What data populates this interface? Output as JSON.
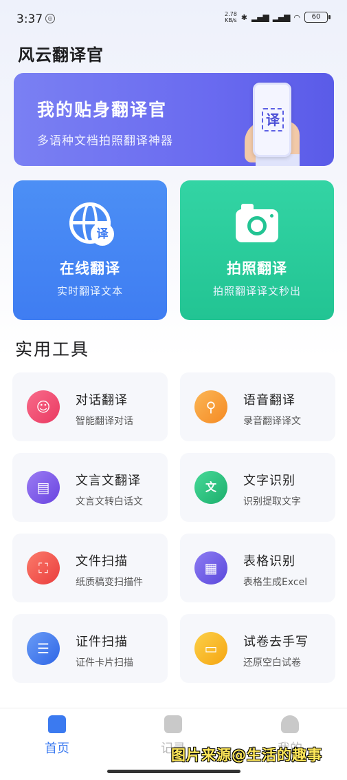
{
  "status_bar": {
    "time": "3:37",
    "net_speed_value": "2.78",
    "net_speed_unit": "KB/s",
    "battery": "60"
  },
  "app": {
    "title": "风云翻译官"
  },
  "banner": {
    "title": "我的贴身翻译官",
    "subtitle": "多语种文档拍照翻译神器",
    "phone_glyph": "译"
  },
  "main_cards": [
    {
      "title": "在线翻译",
      "subtitle": "实时翻译文本",
      "badge": "译",
      "color": "#3f7df2"
    },
    {
      "title": "拍照翻译",
      "subtitle": "拍照翻译译文秒出",
      "color": "#22c493"
    }
  ],
  "section_title": "实用工具",
  "tools": [
    {
      "title": "对话翻译",
      "subtitle": "智能翻译对话",
      "icon": "chat-icon",
      "color": "#f0476f"
    },
    {
      "title": "语音翻译",
      "subtitle": "录音翻译译文",
      "icon": "microphone-icon",
      "color": "#f99a31"
    },
    {
      "title": "文言文翻译",
      "subtitle": "文言文转白话文",
      "icon": "book-icon",
      "color": "#7a57e8"
    },
    {
      "title": "文字识别",
      "subtitle": "识别提取文字",
      "icon": "text-scan-icon",
      "glyph": "文",
      "color": "#26c07f"
    },
    {
      "title": "文件扫描",
      "subtitle": "纸质稿变扫描件",
      "icon": "document-scan-icon",
      "color": "#f2524a"
    },
    {
      "title": "表格识别",
      "subtitle": "表格生成Excel",
      "icon": "table-icon",
      "color": "#6a5be6"
    },
    {
      "title": "证件扫描",
      "subtitle": "证件卡片扫描",
      "icon": "id-card-icon",
      "color": "#3c77ee"
    },
    {
      "title": "试卷去手写",
      "subtitle": "还原空白试卷",
      "icon": "paper-icon",
      "color": "#f8b51c"
    }
  ],
  "bottom_nav": [
    {
      "label": "首页",
      "icon": "home-icon",
      "active": true
    },
    {
      "label": "记录",
      "icon": "record-icon",
      "active": false
    },
    {
      "label": "我的",
      "icon": "profile-icon",
      "active": false
    }
  ],
  "watermark": "图片来源@生活的趣事"
}
